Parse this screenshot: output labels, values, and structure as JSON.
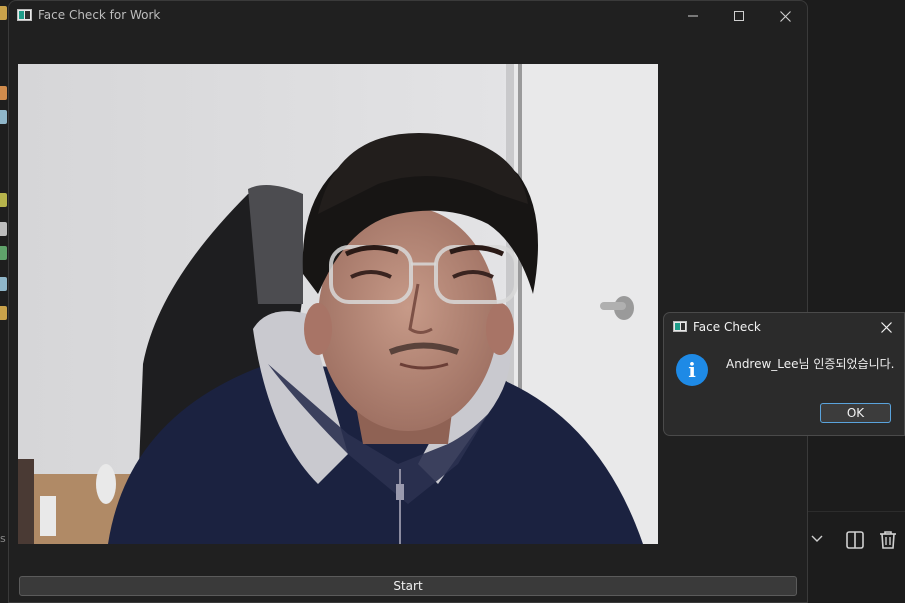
{
  "window": {
    "title": "Face Check for Work",
    "start_label": "Start"
  },
  "dialog": {
    "title": "Face Check",
    "message": "Andrew_Lee님 인증되었습니다.",
    "ok_label": "OK"
  },
  "background": {
    "left_label": "s"
  },
  "icons": [
    "app-icon",
    "minimize-icon",
    "maximize-icon",
    "close-icon",
    "info-icon",
    "chevron-down-icon",
    "split-editor-icon",
    "trash-icon"
  ],
  "colors": {
    "info_blue": "#1e8ae6",
    "ok_border": "#5aa3dc"
  }
}
